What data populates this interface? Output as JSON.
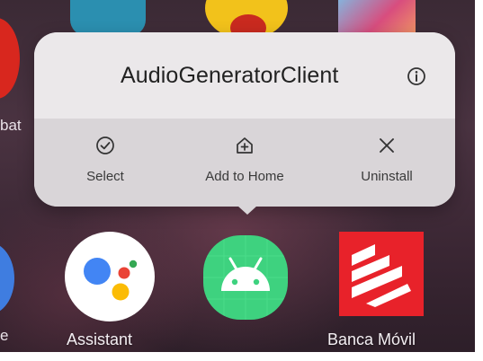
{
  "popup": {
    "title": "AudioGeneratorClient",
    "actions": [
      {
        "label": "Select",
        "icon": "check-circle-icon"
      },
      {
        "label": "Add to Home",
        "icon": "add-to-home-icon"
      },
      {
        "label": "Uninstall",
        "icon": "close-icon"
      }
    ],
    "info_icon": "info-icon"
  },
  "apps": [
    {
      "label": "Assistant",
      "icon": "google-assistant-icon"
    },
    {
      "label": "",
      "icon": "android-icon"
    },
    {
      "label": "Banca Móvil",
      "icon": "banca-movil-icon"
    }
  ],
  "background": {
    "partial_label_left_top": "bat",
    "partial_label_left_bottom": "e"
  },
  "colors": {
    "popup_bg": "#ebe8ea",
    "actions_bg": "#d9d5d8",
    "android_green": "#3ed27f",
    "banca_red": "#e8222a",
    "assistant_blue": "#4285f4",
    "assistant_red": "#ea4335",
    "assistant_yellow": "#fbbc05",
    "assistant_green": "#34a853"
  }
}
